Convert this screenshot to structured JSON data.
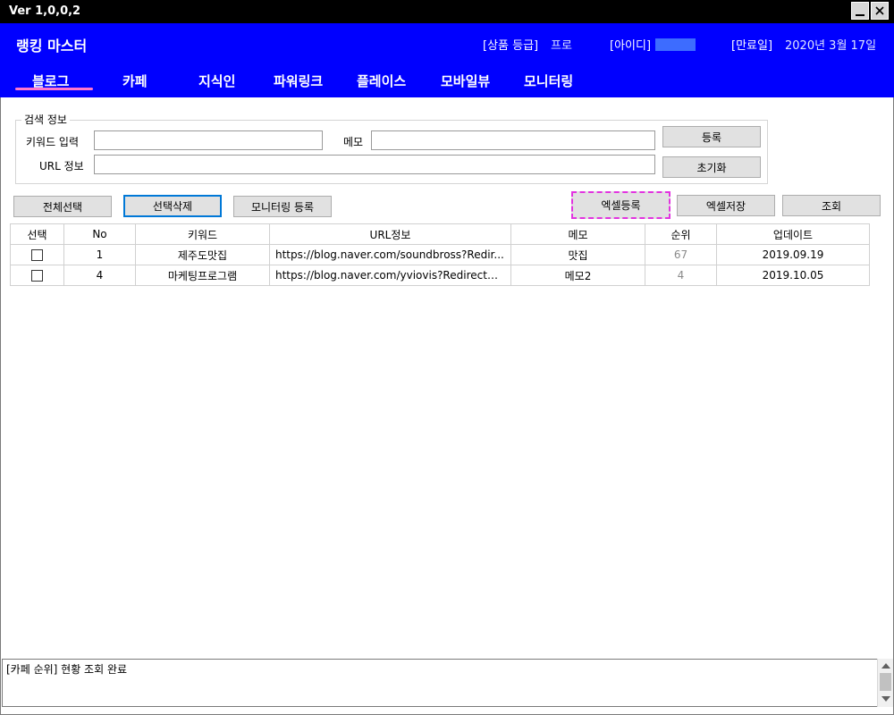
{
  "window": {
    "title": "Ver 1,0,0,2"
  },
  "header": {
    "app_title": "랭킹 마스터",
    "grade_label": "[상품 등급]",
    "grade_value": "프로",
    "id_label": "[아이디]",
    "expiry_label": "[만료일]",
    "expiry_value": "2020년 3월 17일"
  },
  "tabs": [
    "블로그",
    "카페",
    "지식인",
    "파워링크",
    "플레이스",
    "모바일뷰",
    "모니터링"
  ],
  "active_tab": "블로그",
  "search": {
    "group_title": "검색 정보",
    "keyword_label": "키워드 입력",
    "keyword_value": "",
    "memo_label": "메모",
    "memo_value": "",
    "url_label": "URL 정보",
    "url_value": "",
    "register_button": "등록",
    "reset_button": "초기화"
  },
  "toolbar": {
    "select_all": "전체선택",
    "delete_selected": "선택삭제",
    "monitor_register": "모니터링 등록",
    "excel_import": "엑셀등록",
    "excel_save": "엑셀저장",
    "query": "조회"
  },
  "table": {
    "columns": [
      "선택",
      "No",
      "키워드",
      "URL정보",
      "메모",
      "순위",
      "업데이트"
    ],
    "rows": [
      {
        "no": "1",
        "keyword": "제주도맛집",
        "url": "https://blog.naver.com/soundbross?Redir...",
        "memo": "맛집",
        "rank": "67",
        "updated": "2019.09.19"
      },
      {
        "no": "4",
        "keyword": "마케팅프로그램",
        "url": "https://blog.naver.com/yviovis?Redirect=L...",
        "memo": "메모2",
        "rank": "4",
        "updated": "2019.10.05"
      }
    ]
  },
  "log": {
    "text": "[카페 순위] 현황 조회 완료"
  },
  "colors": {
    "header_bg": "#0000ff",
    "titlebar_bg": "#000000",
    "active_tab_underline": "#ff77cc",
    "excel_button_border": "#e234e0"
  }
}
